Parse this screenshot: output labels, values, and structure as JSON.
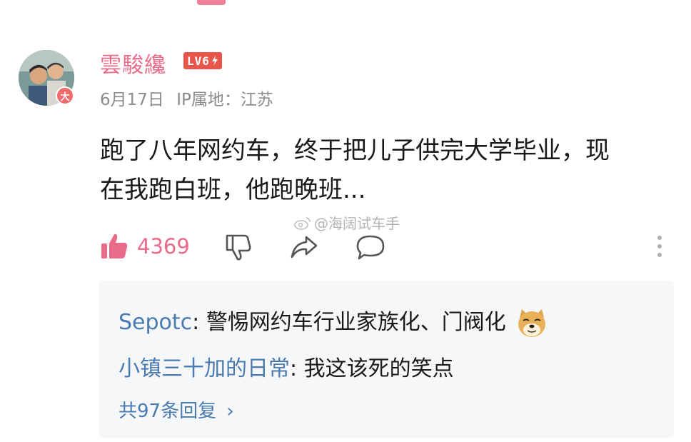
{
  "comment": {
    "username": "雲駿纔",
    "level": "LV6",
    "vip_badge": "大",
    "date": "6月17日",
    "ip_location": "IP属地：江苏",
    "text_line1": "跑了八年网约车，终于把儿子供完大学毕业，现",
    "text_line2": "在我跑白班，他跑晚班...",
    "likes": "4369"
  },
  "watermark": {
    "text": "@海阔试车手"
  },
  "replies": {
    "items": [
      {
        "name": "Sepotc",
        "text": "警惕网约车行业家族化、门阀化",
        "emoji": "doge-emoji"
      },
      {
        "name": "小镇三十加的日常",
        "text": "我这该死的笑点"
      }
    ],
    "total_label": "共97条回复",
    "total_chevron": "›"
  },
  "colors": {
    "accent_pink": "#ea6b8a",
    "link_blue": "#4a7bb0",
    "meta_gray": "#8a8a8a",
    "reply_bg": "#f6f7f9"
  },
  "icons": [
    "thumbs-up-icon",
    "thumbs-down-icon",
    "share-icon",
    "reply-bubble-icon",
    "more-vertical-icon",
    "weibo-icon"
  ]
}
